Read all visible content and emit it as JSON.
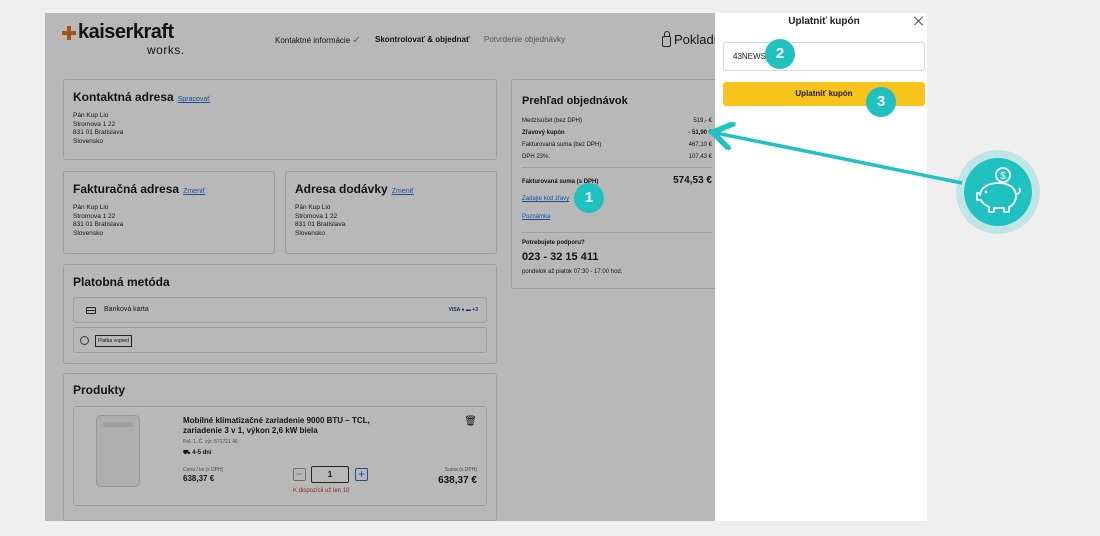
{
  "header": {
    "logo_name": "kaiserkraft",
    "logo_sub": "works.",
    "steps": [
      "Kontaktné informácie",
      "Skontrolovať & objednať",
      "Potvrdenie objednávky"
    ],
    "step_done_mark": "✓",
    "cart_label": "Pokladň"
  },
  "contact": {
    "title": "Kontaktná adresa",
    "edit": "Spracovať",
    "lines": "Pán Kup Lio\nStromova 1 22\n831 01 Bratislava\nSlovensko"
  },
  "billing": {
    "title": "Fakturačná adresa",
    "edit": "Zmeniť",
    "lines": "Pán Kup Lio\nStromova 1 22\n831 01 Bratislava\nSlovensko"
  },
  "delivery": {
    "title": "Adresa dodávky",
    "edit": "Zmeniť",
    "lines": "Pán Kup Lio\nStromova 1 22\n831 01 Bratislava\nSlovensko"
  },
  "payment": {
    "title": "Platobná metóda",
    "option1": "Banková karta",
    "option1_brands": "VISA ● ▬ +3",
    "option2": "Platba vopred"
  },
  "products": {
    "title": "Produkty",
    "item": {
      "name": "Mobilné klimatizačné zariadenie 9000 BTU – TCL, zariadenie 3 v 1, výkon 2,6 kW biela",
      "code": "Pol. 1.  Č. výr. 571721 46",
      "delivery": "4-5 dní",
      "unit_label": "Cena / ks (s DPH)",
      "unit_price": "638,37 €",
      "qty": "1",
      "minus": "−",
      "plus": "+",
      "stock_note": "K dispozícii už len 10",
      "sum_label": "Suma (s DPH)",
      "sum": "638,37 €"
    }
  },
  "summary": {
    "title": "Prehľad objednávok",
    "rows": [
      {
        "label": "Medzisúčet (bez DPH)",
        "value": "519,- €"
      },
      {
        "label": "Zľavový kupón",
        "value": "- 51,90 €"
      },
      {
        "label": "Fakturovaná suma (bez DPH)",
        "value": "467,10 €"
      },
      {
        "label": "DPH 23%:",
        "value": "107,43 €"
      }
    ],
    "total_label": "Fakturovaná suma (s DPH)",
    "total_value": "574,53 €",
    "discount_link": "Zadajte kód zľavy",
    "note_link": "Poznámka",
    "support_title": "Potrebujete podporu?",
    "phone": "023 - 32 15 411",
    "hours": "pondelok až piatok 07:30 - 17:00 hod."
  },
  "drawer": {
    "title": "Uplatniť kupón",
    "coupon_value": "43NEWS",
    "apply_label": "Uplatniť kupón"
  },
  "badges": [
    "1",
    "2",
    "3"
  ],
  "colors": {
    "accent_yellow": "#f8c41c",
    "badge_teal": "#1fc2c0",
    "link_blue": "#2a6fd6",
    "logo_orange": "#e8731a"
  },
  "icons": [
    "close-icon",
    "lock-icon",
    "trash-icon",
    "truck-icon",
    "card-icon",
    "piggy-bank-icon"
  ]
}
